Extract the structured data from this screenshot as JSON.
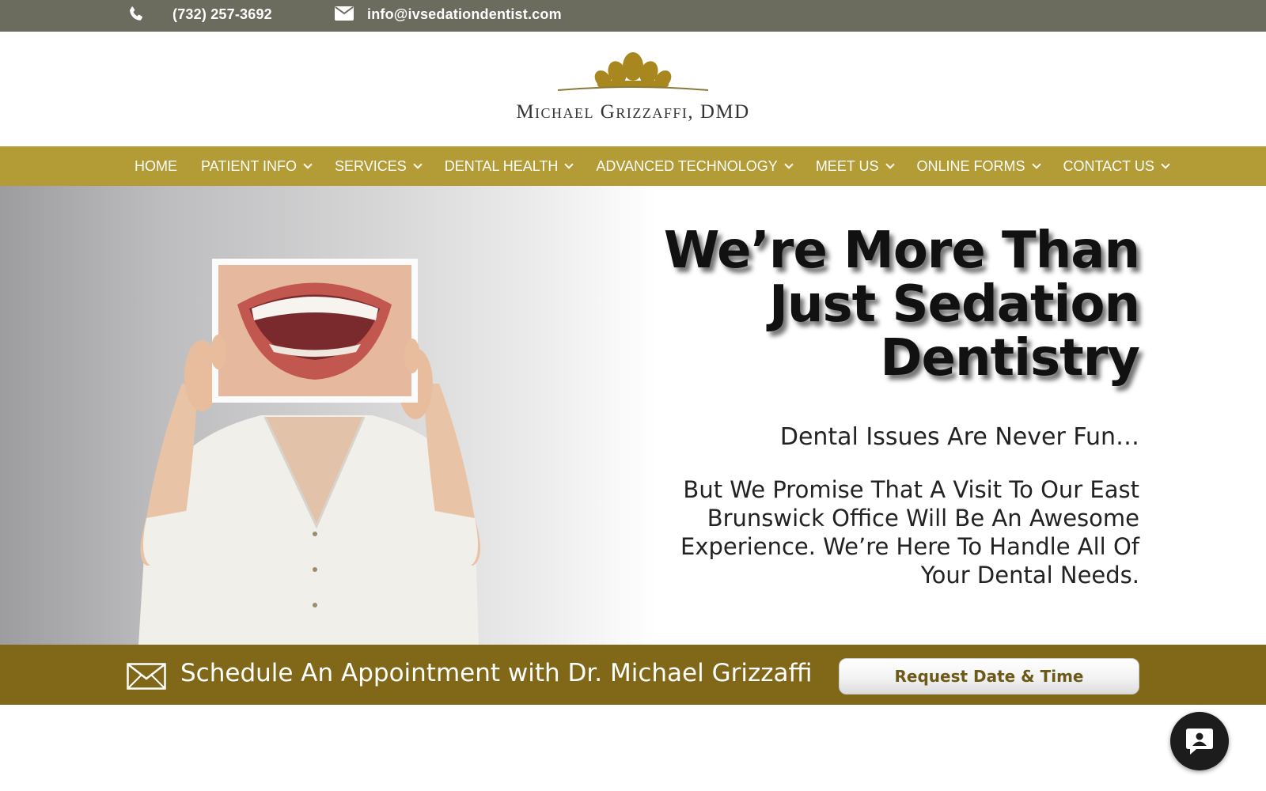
{
  "topbar": {
    "phone": "(732) 257-3692",
    "email": "info@ivsedationdentist.com",
    "phone_icon": "phone-icon",
    "email_icon": "mail-icon"
  },
  "header": {
    "logo_text": "Michael Grizzaffi, DMD",
    "logo_icon": "tooth-crown-logo"
  },
  "nav": {
    "items": [
      {
        "label": "HOME",
        "has_dropdown": false
      },
      {
        "label": "PATIENT INFO",
        "has_dropdown": true
      },
      {
        "label": "SERVICES",
        "has_dropdown": true
      },
      {
        "label": "DENTAL HEALTH",
        "has_dropdown": true
      },
      {
        "label": "ADVANCED TECHNOLOGY",
        "has_dropdown": true
      },
      {
        "label": "MEET US",
        "has_dropdown": true
      },
      {
        "label": "ONLINE FORMS",
        "has_dropdown": true
      },
      {
        "label": "CONTACT US",
        "has_dropdown": true
      }
    ]
  },
  "hero": {
    "headline_line1": "We’re More Than",
    "headline_line2": "Just Sedation",
    "headline_line3": "Dentistry",
    "subheading": "Dental Issues Are Never Fun…",
    "body": "But We Promise That A Visit To Our East Brunswick Office Will Be An Awesome Experience. We’re Here To Handle All Of Your Dental Needs."
  },
  "cta": {
    "text": "Schedule An Appointment with Dr. Michael Grizzaffi",
    "button_label": "Request Date & Time",
    "icon": "envelope-icon"
  },
  "chat": {
    "icon": "chat-icon"
  },
  "colors": {
    "topbar": "#6b6b5e",
    "nav": "#b39b35",
    "cta_bar": "#816818",
    "button_text": "#6e5a18"
  }
}
